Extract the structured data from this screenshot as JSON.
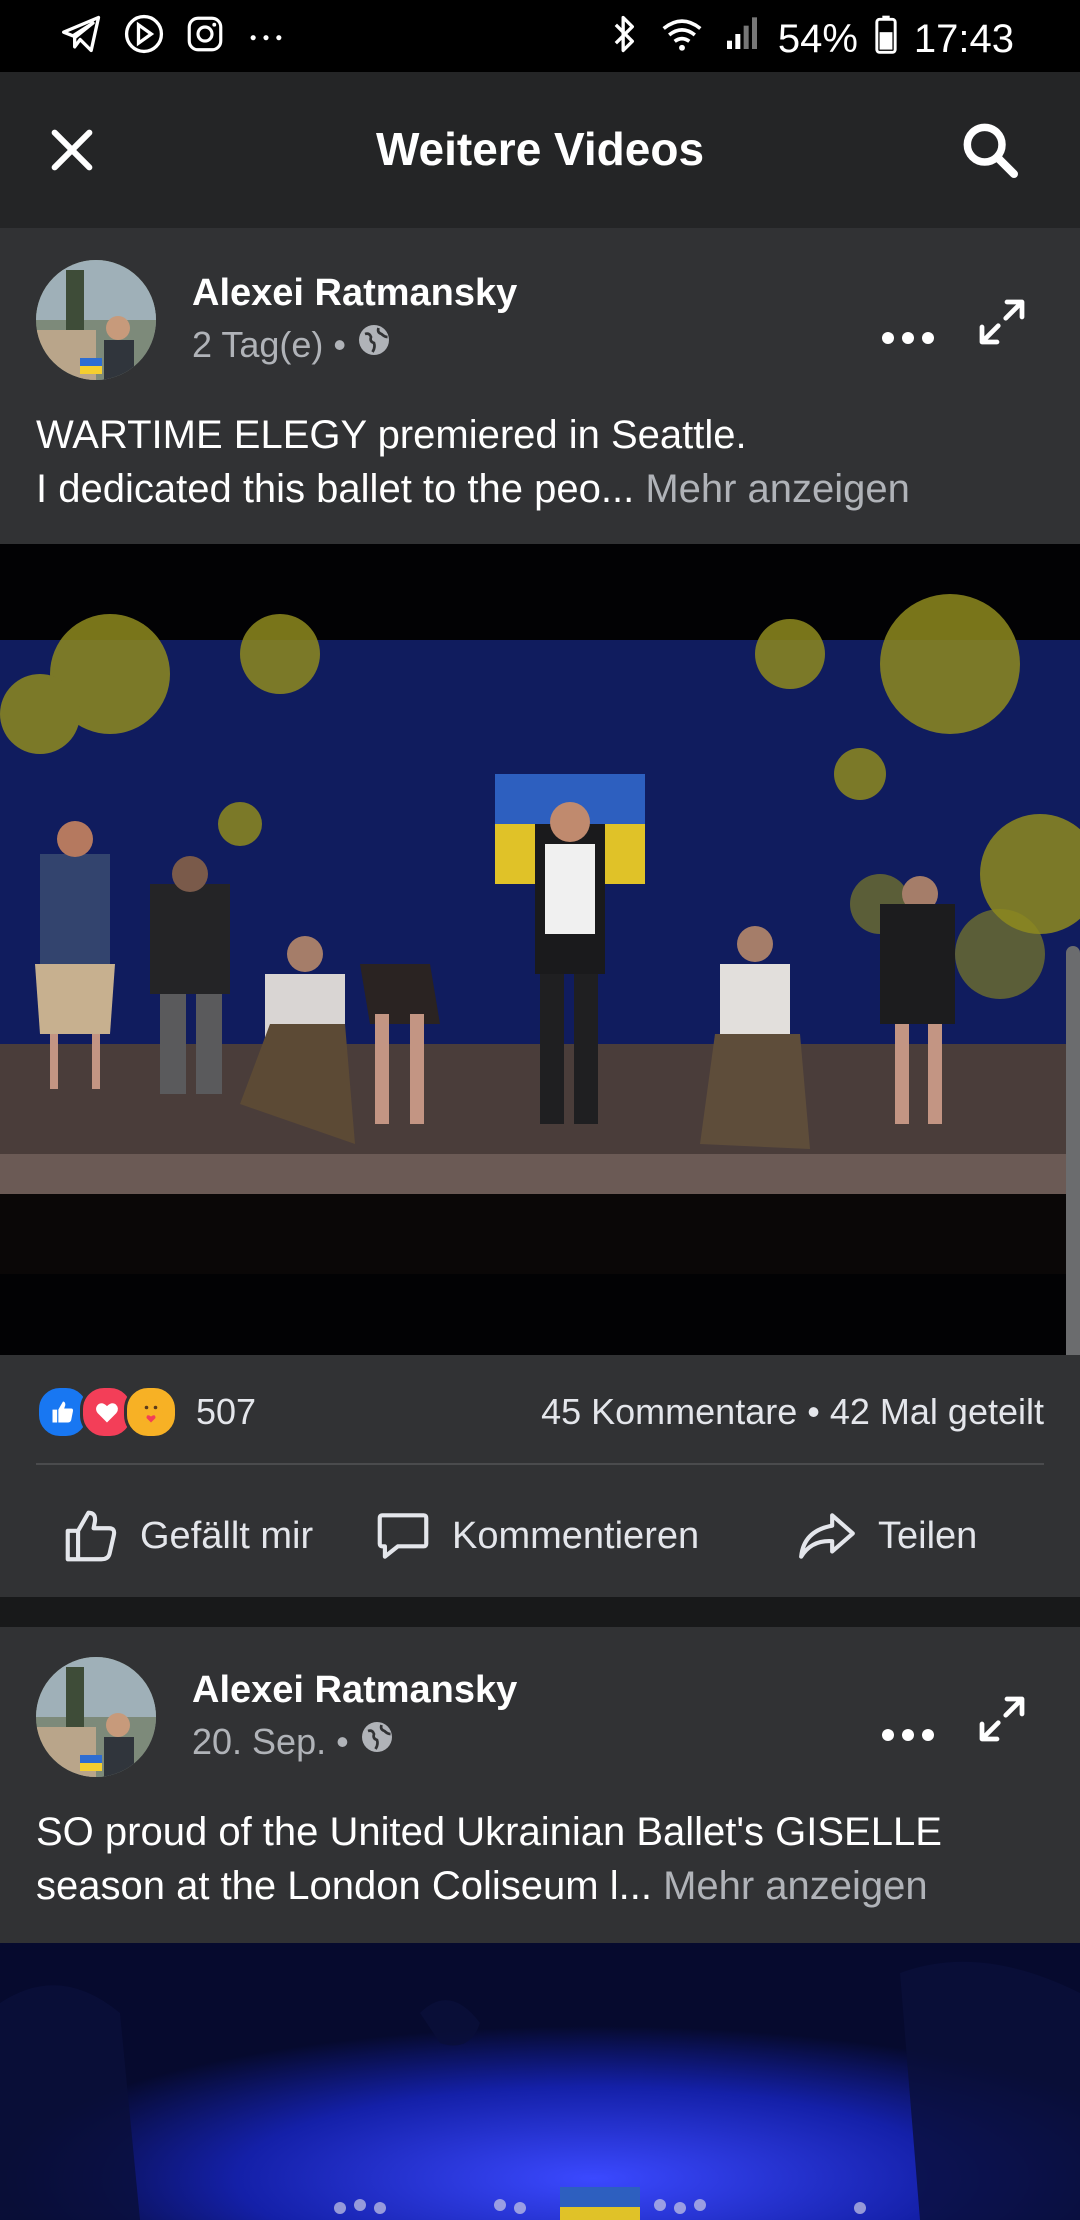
{
  "status_bar": {
    "battery": "54%",
    "time": "17:43",
    "left_icons": [
      "telegram-icon",
      "clock-play-icon",
      "instagram-icon",
      "more-dots-icon"
    ],
    "right_icons": [
      "bluetooth-icon",
      "wifi-icon",
      "signal-icon",
      "battery-icon"
    ]
  },
  "app_bar": {
    "title": "Weitere Videos",
    "close_icon": "close-icon",
    "search_icon": "search-icon"
  },
  "posts": [
    {
      "author": "Alexei Ratmansky",
      "time": "2 Tag(e)",
      "separator": "•",
      "privacy_icon": "globe-icon",
      "text_line1": "WARTIME ELEGY premiered in Seattle.",
      "text_line2": "I dedicated this ballet to the peo...",
      "see_more": "Mehr anzeigen",
      "reactions": [
        "like",
        "love",
        "care"
      ],
      "reaction_count": "507",
      "comments": "45 Kommentare",
      "shares": "42 Mal geteilt",
      "actions": {
        "like": "Gefällt mir",
        "comment": "Kommentieren",
        "share": "Teilen"
      }
    },
    {
      "author": "Alexei Ratmansky",
      "time": "20. Sep.",
      "separator": "•",
      "privacy_icon": "globe-icon",
      "text_line1": "SO proud of the United Ukrainian Ballet's GISELLE",
      "text_line2": "season at the London Coliseum l...",
      "see_more": "Mehr anzeigen"
    }
  ],
  "colors": {
    "background": "#18191a",
    "card": "#313234",
    "app_bar": "#242526",
    "like_blue": "#1877f2",
    "love_red": "#f33e58",
    "care_yellow": "#f7b125"
  }
}
